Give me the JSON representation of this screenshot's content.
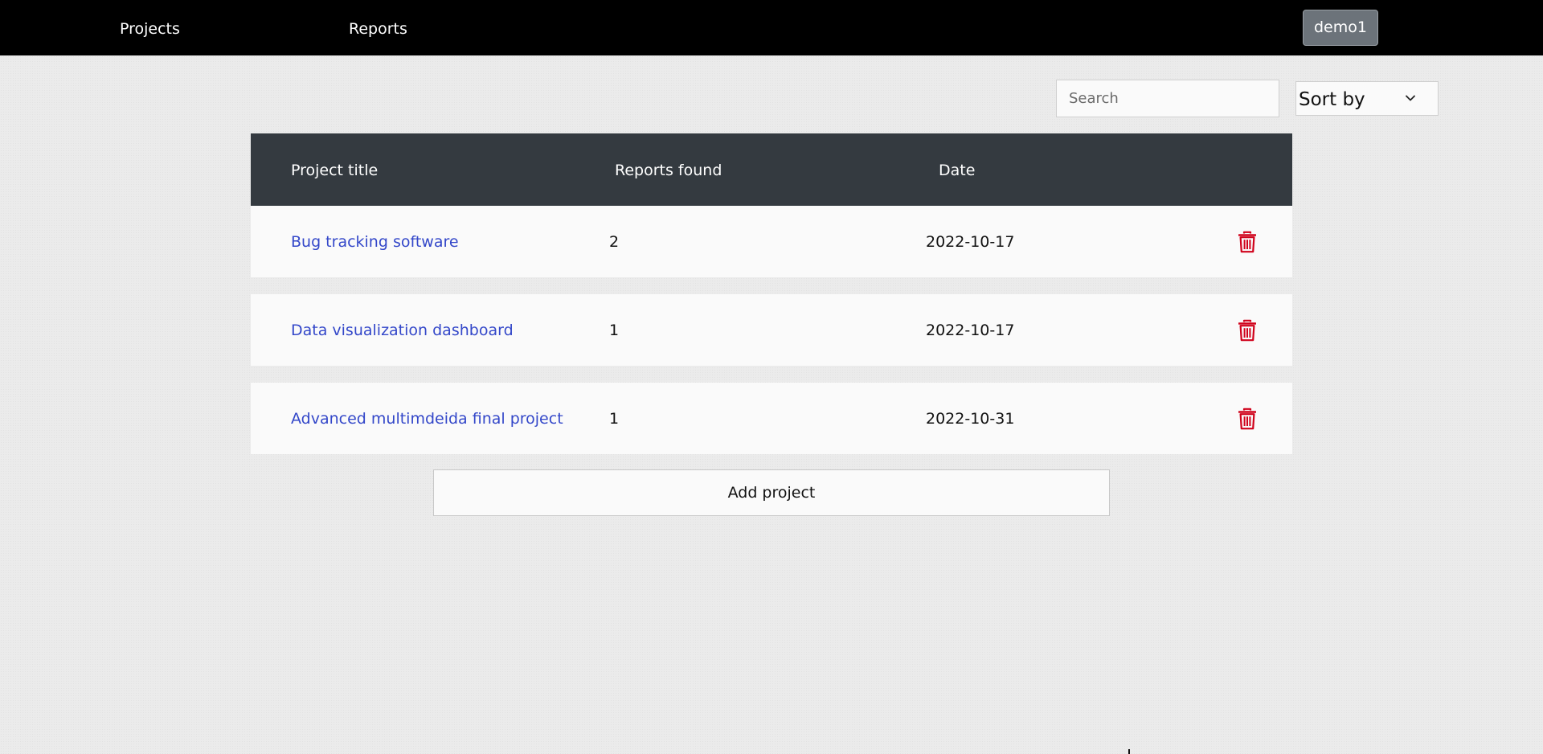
{
  "nav": {
    "projects_label": "Projects",
    "reports_label": "Reports",
    "user_label": "demo1"
  },
  "toolbar": {
    "search_placeholder": "Search",
    "sort_label": "Sort by"
  },
  "table": {
    "columns": [
      "Project title",
      "Reports found",
      "Date"
    ],
    "rows": [
      {
        "title": "Bug tracking software",
        "reports": "2",
        "date": "2022-10-17"
      },
      {
        "title": "Data visualization dashboard",
        "reports": "1",
        "date": "2022-10-17"
      },
      {
        "title": "Advanced multimdeida final project",
        "reports": "1",
        "date": "2022-10-31"
      }
    ],
    "row_action_icon": "trash-icon"
  },
  "actions": {
    "add_project_label": "Add project"
  },
  "colors": {
    "navbar": "#000000",
    "table_header": "#343a40",
    "link": "#3347c9",
    "delete": "#d0021b",
    "user_button": "#6c737a"
  }
}
